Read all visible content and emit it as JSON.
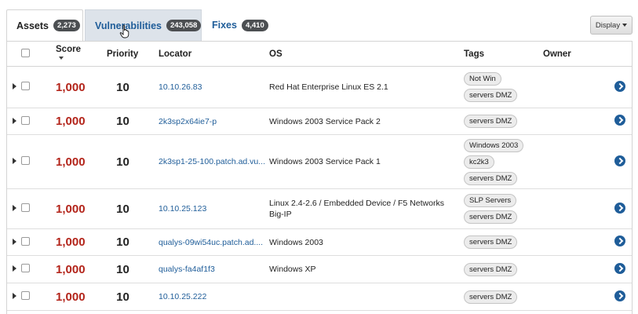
{
  "tabs": {
    "assets": {
      "label": "Assets",
      "count": "2,273"
    },
    "vulnerabilities": {
      "label": "Vulnerabilities",
      "count": "243,058"
    },
    "fixes": {
      "label": "Fixes",
      "count": "4,410"
    }
  },
  "display_button": {
    "label": "Display"
  },
  "table": {
    "headers": {
      "score": "Score",
      "priority": "Priority",
      "locator": "Locator",
      "os": "OS",
      "tags": "Tags",
      "owner": "Owner"
    },
    "rows": [
      {
        "score": "1,000",
        "priority": "10",
        "locator": "10.10.26.83",
        "os": "Red Hat Enterprise Linux ES 2.1",
        "tags": [
          "Not Win",
          "servers DMZ"
        ]
      },
      {
        "score": "1,000",
        "priority": "10",
        "locator": "2k3sp2x64ie7-p",
        "os": "Windows 2003 Service Pack 2",
        "tags": [
          "servers DMZ"
        ]
      },
      {
        "score": "1,000",
        "priority": "10",
        "locator": "2k3sp1-25-100.patch.ad.vu...",
        "os": "Windows 2003 Service Pack 1",
        "tags": [
          "Windows 2003",
          "kc2k3",
          "servers DMZ"
        ]
      },
      {
        "score": "1,000",
        "priority": "10",
        "locator": "10.10.25.123",
        "os": "Linux 2.4-2.6 / Embedded Device / F5 Networks Big-IP",
        "tags": [
          "SLP Servers",
          "servers DMZ"
        ]
      },
      {
        "score": "1,000",
        "priority": "10",
        "locator": "qualys-09wi54uc.patch.ad....",
        "os": "Windows 2003",
        "tags": [
          "servers DMZ"
        ]
      },
      {
        "score": "1,000",
        "priority": "10",
        "locator": "qualys-fa4af1f3",
        "os": "Windows XP",
        "tags": [
          "servers DMZ"
        ]
      },
      {
        "score": "1,000",
        "priority": "10",
        "locator": "10.10.25.222",
        "os": "",
        "tags": [
          "servers DMZ"
        ]
      }
    ]
  },
  "colors": {
    "score": "#b3241a",
    "link": "#1f5d99",
    "badge": "#4c4f52",
    "active_tab_bg": "#dde3ea"
  },
  "icons": {
    "expand": "caret-right-icon",
    "go": "circle-chevron-right-icon",
    "sort": "sort-desc-icon",
    "cursor": "hand-pointer-icon"
  }
}
